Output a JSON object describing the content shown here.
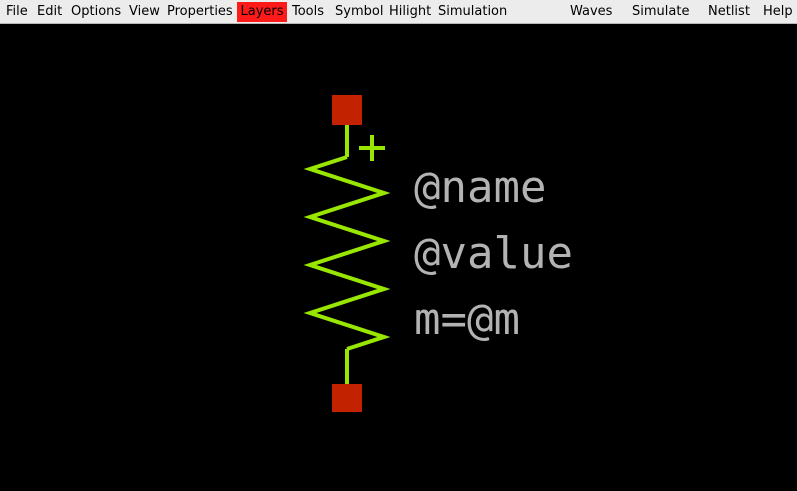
{
  "menubar": {
    "items": [
      {
        "label": "File"
      },
      {
        "label": "Edit"
      },
      {
        "label": "Options"
      },
      {
        "label": "View"
      },
      {
        "label": "Properties"
      },
      {
        "label": "Layers",
        "active": true
      },
      {
        "label": "Tools"
      },
      {
        "label": "Symbol"
      },
      {
        "label": "Hilight"
      },
      {
        "label": "Simulation"
      },
      {
        "label": "Waves"
      },
      {
        "label": "Simulate"
      },
      {
        "label": "Netlist"
      },
      {
        "label": "Help"
      }
    ],
    "active_color": "#ff1a1a"
  },
  "symbol": {
    "polarity_mark": "+",
    "attributes": {
      "name": "@name",
      "value": "@value",
      "multiplier": "m=@m"
    },
    "wire_color": "#99e600",
    "pin_color": "#c32200",
    "text_color": "#b3b3b3"
  },
  "canvas": {
    "background": "#000000"
  }
}
